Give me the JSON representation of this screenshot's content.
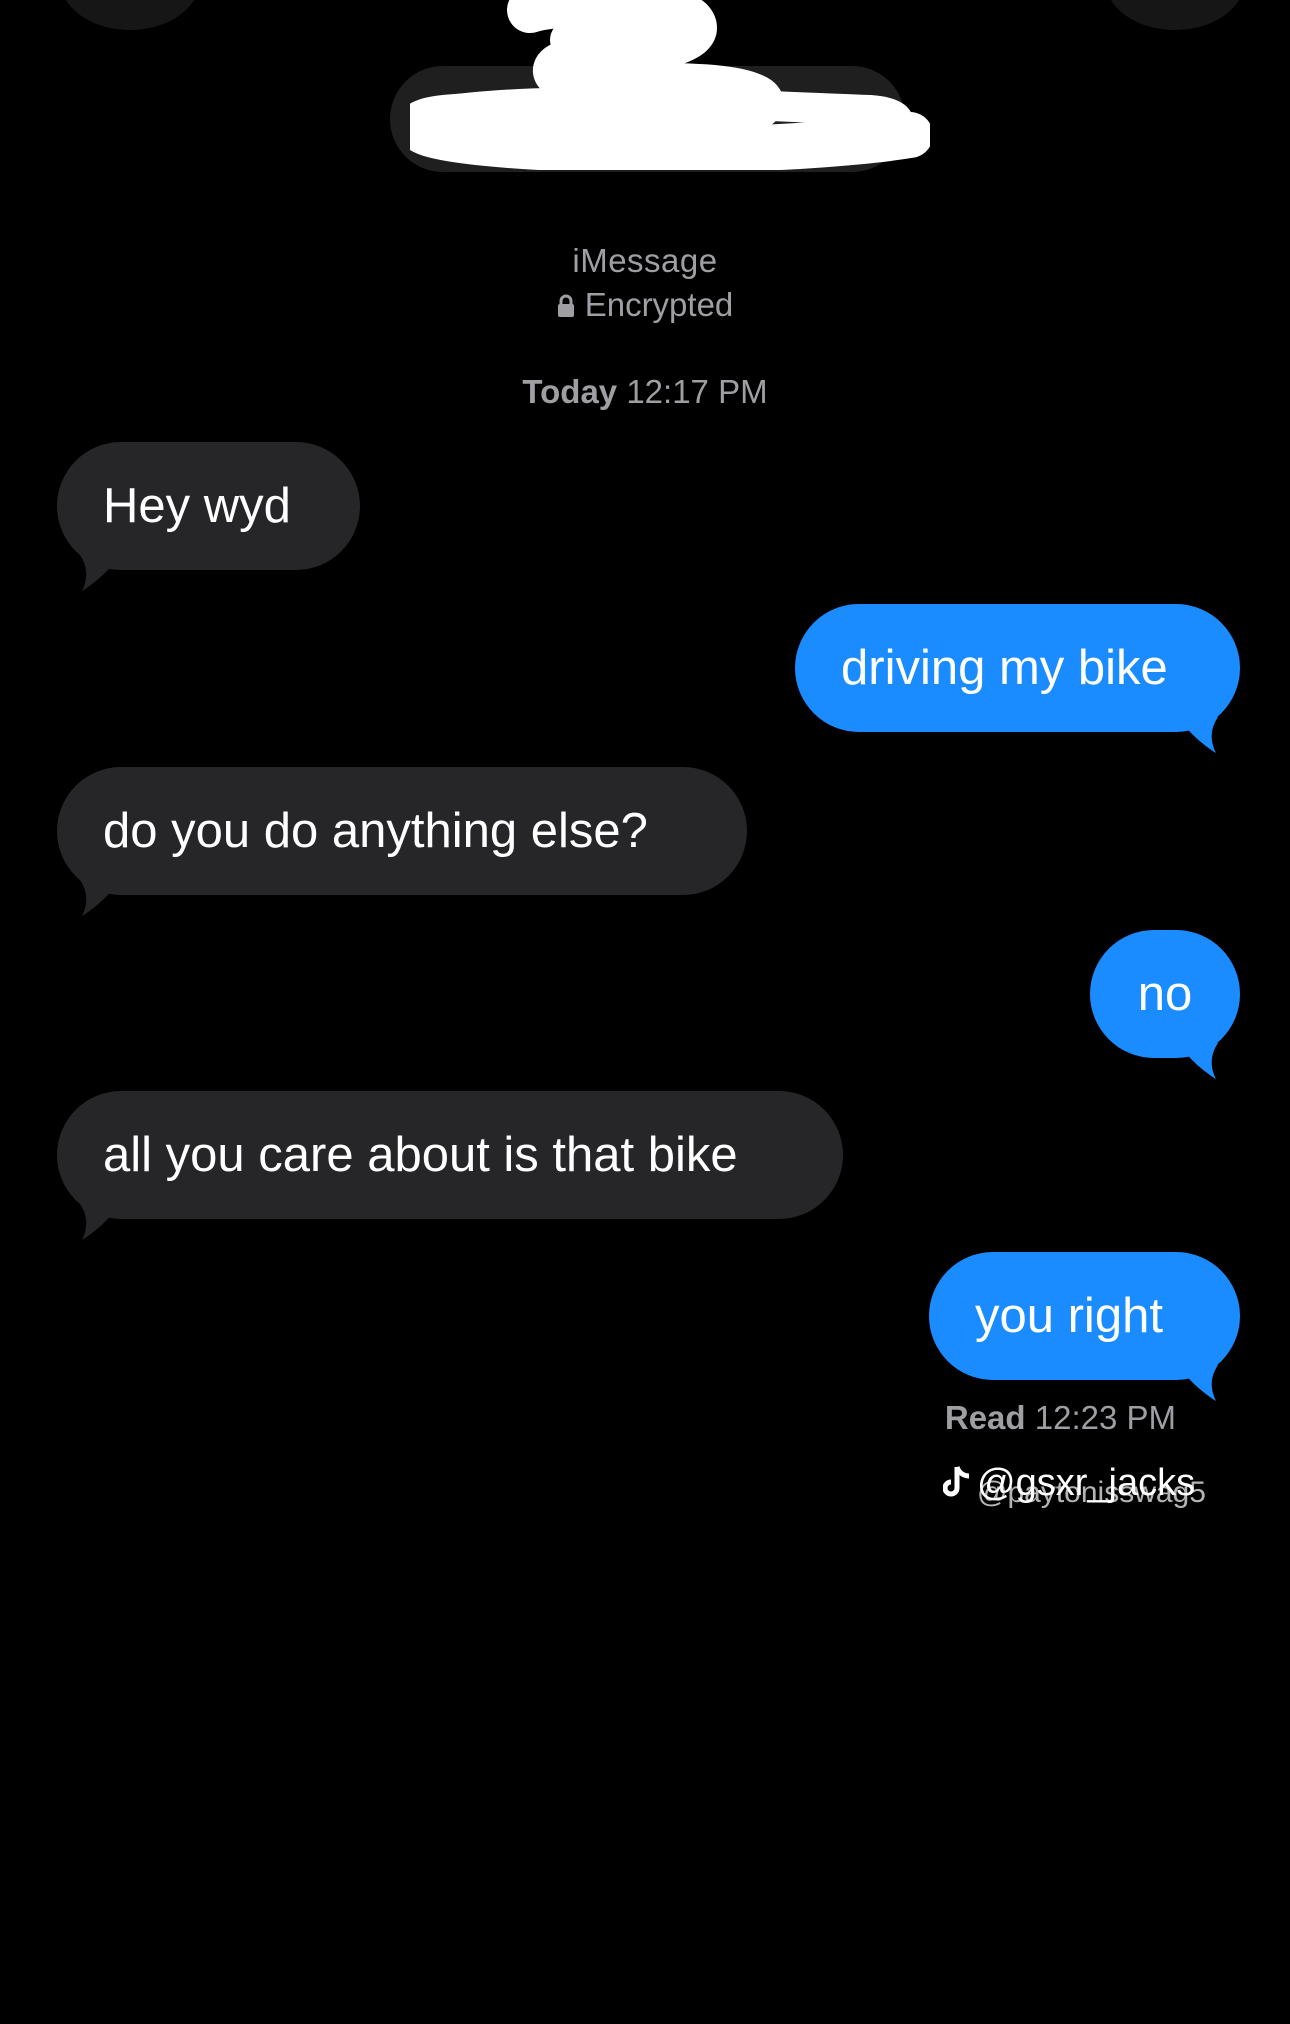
{
  "header": {
    "contact_name": "",
    "service_label": "iMessage",
    "encryption_label": "Encrypted",
    "timestamp_day": "Today",
    "timestamp_time": "12:17 PM"
  },
  "messages": [
    {
      "direction": "incoming",
      "text": "Hey wyd"
    },
    {
      "direction": "outgoing",
      "text": "driving my bike"
    },
    {
      "direction": "incoming",
      "text": "do you do anything else?"
    },
    {
      "direction": "outgoing",
      "text": "no"
    },
    {
      "direction": "incoming",
      "text": "all you care about is that bike"
    },
    {
      "direction": "outgoing",
      "text": "you right"
    }
  ],
  "read_receipt": {
    "label": "Read",
    "time": "12:23 PM"
  },
  "watermark": {
    "handle": "@gsxr_jacks",
    "overlapping_handle": "@paytonisswag5",
    "icon": "tiktok-note-icon"
  },
  "colors": {
    "background": "#000000",
    "incoming_bubble": "#262628",
    "outgoing_bubble": "#1a8cff",
    "meta_text": "#9e9ea3"
  }
}
